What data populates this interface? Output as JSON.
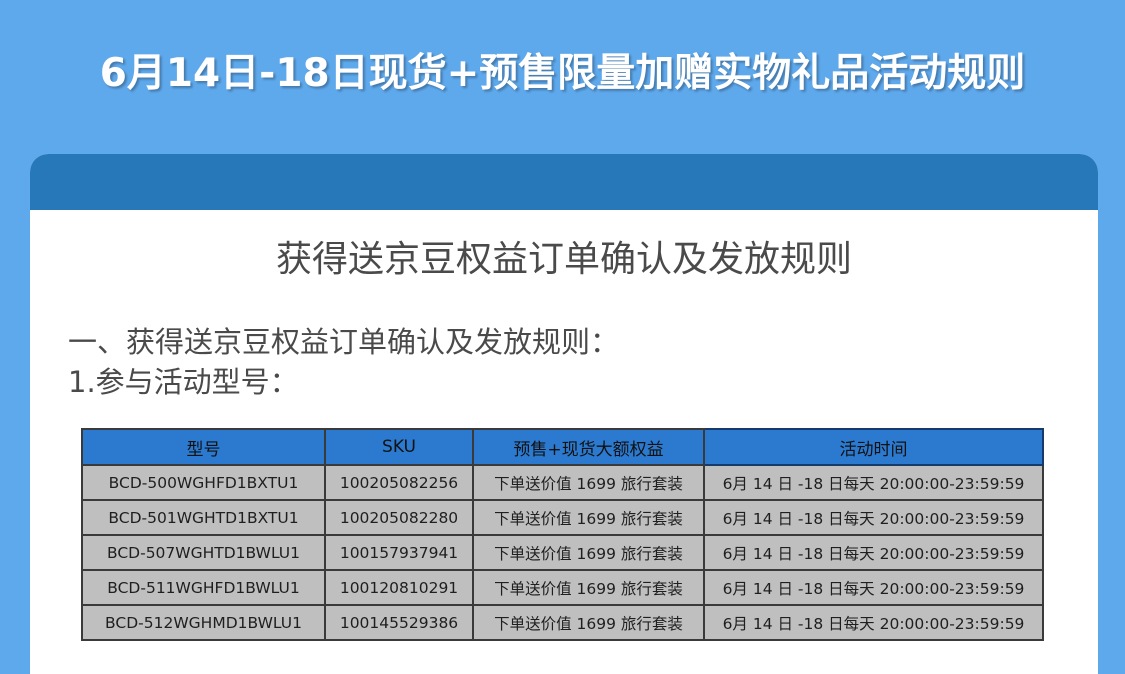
{
  "banner": {
    "title": "6月14日-18日现货+预售限量加赠实物礼品活动规则"
  },
  "card": {
    "title": "获得送京豆权益订单确认及发放规则",
    "section_heading": "一、获得送京豆权益订单确认及发放规则：",
    "sub_heading": "1.参与活动型号："
  },
  "table": {
    "headers": [
      "型号",
      "SKU",
      "预售+现货大额权益",
      "活动时间"
    ],
    "rows": [
      [
        "BCD-500WGHFD1BXTU1",
        "100205082256",
        "下单送价值 1699 旅行套装",
        "6月 14 日  -18 日每天 20:00:00-23:59:59"
      ],
      [
        "BCD-501WGHTD1BXTU1",
        "100205082280",
        "下单送价值 1699 旅行套装",
        "6月 14 日  -18 日每天 20:00:00-23:59:59"
      ],
      [
        "BCD-507WGHTD1BWLU1",
        "100157937941",
        "下单送价值 1699 旅行套装",
        "6月 14 日  -18 日每天 20:00:00-23:59:59"
      ],
      [
        "BCD-511WGHFD1BWLU1",
        "100120810291",
        "下单送价值 1699 旅行套装",
        "6月 14 日  -18 日每天 20:00:00-23:59:59"
      ],
      [
        "BCD-512WGHMD1BWLU1",
        "100145529386",
        "下单送价值 1699 旅行套装",
        "6月 14 日  -18 日每天 20:00:00-23:59:59"
      ]
    ]
  },
  "colors": {
    "page_background": "#5ea8ec",
    "card_header": "#2778b9",
    "table_header": "#2b7ad0",
    "table_cell": "#bfbfbf"
  }
}
